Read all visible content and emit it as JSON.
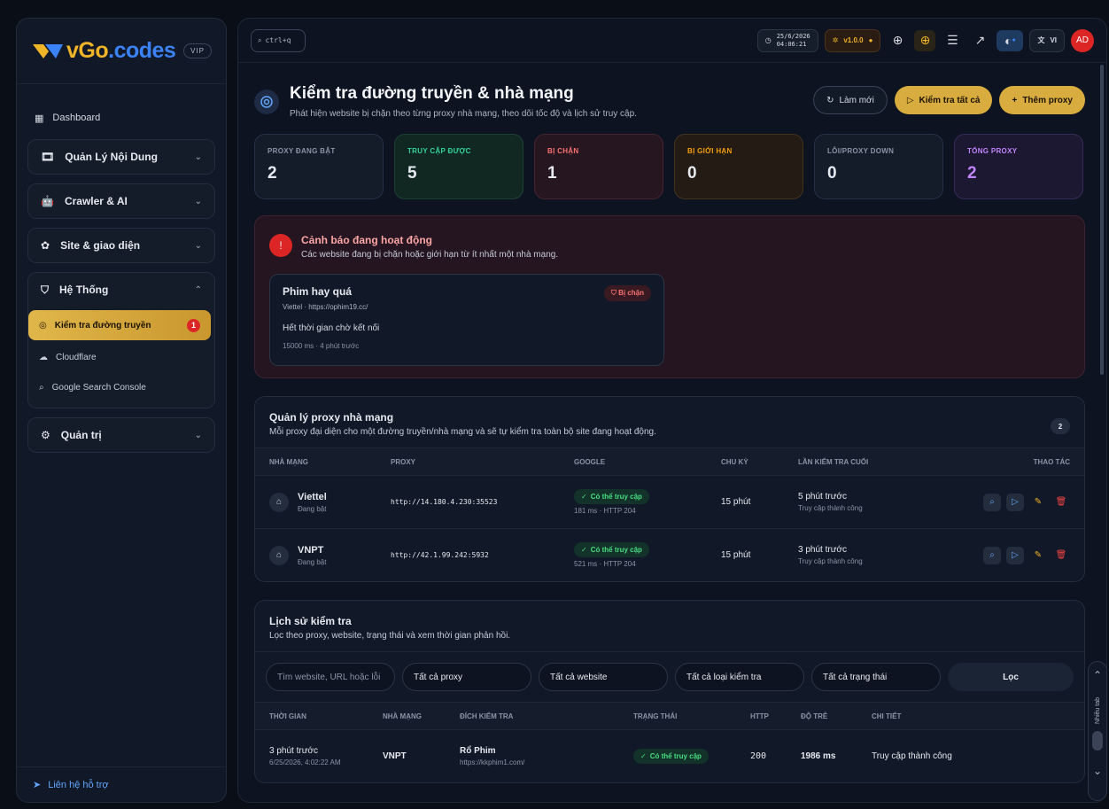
{
  "sidebar": {
    "logo_a": "Go",
    "logo_b": ".codes",
    "logo_prefix": "v",
    "vip": "VIP",
    "dashboard": "Dashboard",
    "groups": [
      {
        "label": "Quản Lý Nội Dung",
        "icon": "film-icon"
      },
      {
        "label": "Crawler & AI",
        "icon": "robot-icon"
      },
      {
        "label": "Site & giao diện",
        "icon": "palette-icon"
      }
    ],
    "system": {
      "label": "Hệ Thống",
      "items": [
        {
          "label": "Kiểm tra đường truyền",
          "count": "1"
        },
        {
          "label": "Cloudflare"
        },
        {
          "label": "Google Search Console"
        }
      ]
    },
    "admin": "Quản trị",
    "support": "Liên hệ hỗ trợ"
  },
  "topbar": {
    "search_hint": "ctrl+q",
    "date": "25/6/2026",
    "time": "04:06:21",
    "version": "v1.0.0",
    "lang": "VI",
    "avatar": "AD"
  },
  "page": {
    "title": "Kiểm tra đường truyền & nhà mạng",
    "subtitle": "Phát hiện website bị chặn theo từng proxy nhà mạng, theo dõi tốc độ và lịch sử truy cập.",
    "refresh": "Làm mới",
    "check_all": "Kiểm tra tất cả",
    "add_proxy": "Thêm proxy"
  },
  "stats": [
    {
      "label": "PROXY ĐANG BẬT",
      "value": "2"
    },
    {
      "label": "TRUY CẬP ĐƯỢC",
      "value": "5"
    },
    {
      "label": "BỊ CHẶN",
      "value": "1"
    },
    {
      "label": "BỊ GIỚI HẠN",
      "value": "0"
    },
    {
      "label": "LỖI/PROXY DOWN",
      "value": "0"
    },
    {
      "label": "TỔNG PROXY",
      "value": "2"
    }
  ],
  "alert": {
    "title": "Cảnh báo đang hoạt động",
    "subtitle": "Các website đang bị chặn hoặc giới hạn từ ít nhất một nhà mạng.",
    "card": {
      "name": "Phim hay quá",
      "meta": "Viettel · https://ophim19.cc/",
      "badge": "Bị chặn",
      "message": "Hết thời gian chờ kết nối",
      "footer": "15000 ms · 4 phút trước"
    }
  },
  "proxies": {
    "title": "Quản lý proxy nhà mạng",
    "subtitle": "Mỗi proxy đại diện cho một đường truyền/nhà mạng và sẽ tự kiểm tra toàn bộ site đang hoạt động.",
    "count": "2",
    "headers": [
      "NHÀ MẠNG",
      "PROXY",
      "GOOGLE",
      "CHU KỲ",
      "LẦN KIỂM TRA CUỐI",
      "THAO TÁC"
    ],
    "rows": [
      {
        "name": "Viettel",
        "state": "Đang bật",
        "proxy": "http://14.180.4.230:35523",
        "google": "Có thể truy cập",
        "google_meta": "181 ms · HTTP 204",
        "cycle": "15 phút",
        "last": "5 phút trước",
        "last_meta": "Truy cập thành công"
      },
      {
        "name": "VNPT",
        "state": "Đang bật",
        "proxy": "http://42.1.99.242:5932",
        "google": "Có thể truy cập",
        "google_meta": "521 ms · HTTP 204",
        "cycle": "15 phút",
        "last": "3 phút trước",
        "last_meta": "Truy cập thành công"
      }
    ]
  },
  "history": {
    "title": "Lịch sử kiểm tra",
    "subtitle": "Lọc theo proxy, website, trạng thái và xem thời gian phản hồi.",
    "search_placeholder": "Tìm website, URL hoặc lỗi",
    "filter_proxy": "Tất cả proxy",
    "filter_website": "Tất cả website",
    "filter_type": "Tất cả loại kiểm tra",
    "filter_status": "Tất cả trạng thái",
    "filter_button": "Lọc",
    "headers": [
      "THỜI GIAN",
      "NHÀ MẠNG",
      "ĐÍCH KIỂM TRA",
      "TRẠNG THÁI",
      "HTTP",
      "ĐỘ TRỄ",
      "CHI TIẾT"
    ],
    "rows": [
      {
        "time": "3 phút trước",
        "time_meta": "6/25/2026, 4:02:22 AM",
        "network": "VNPT",
        "target": "Rổ Phim",
        "target_url": "https://kkphim1.com/",
        "status": "Có thể truy cập",
        "http": "200",
        "latency": "1986 ms",
        "detail": "Truy cập thành công"
      }
    ]
  },
  "scroll_widget": {
    "label": "Nhiều tab"
  }
}
